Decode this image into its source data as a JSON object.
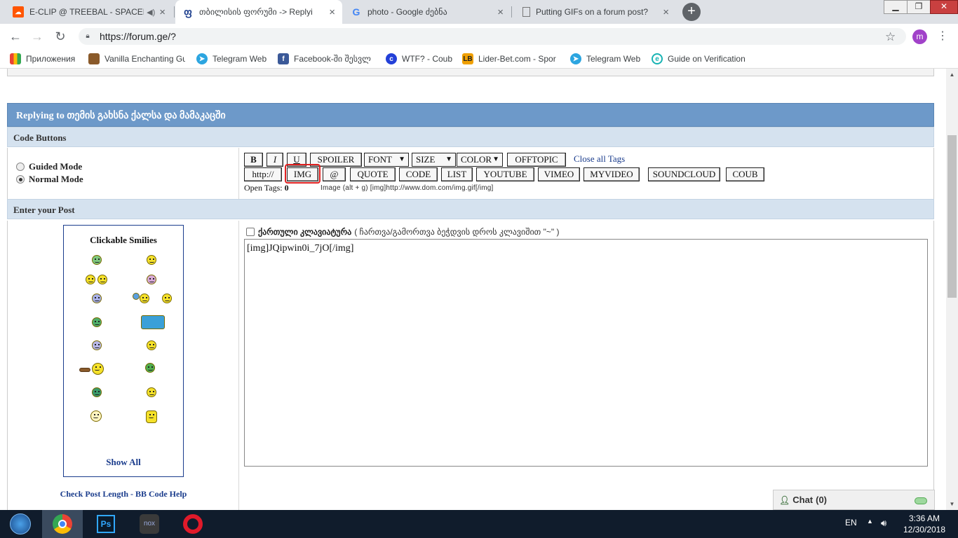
{
  "browser": {
    "tabs": [
      {
        "title": "E-CLIP @ TREEBAL - SPACEH",
        "has_audio": true
      },
      {
        "title": "თბილისის ფორუმი -> Replyi",
        "active": true
      },
      {
        "title": "photo - Google ძებნა"
      },
      {
        "title": "Putting GIFs on a forum post?"
      }
    ],
    "url": "https://forum.ge/?",
    "avatar_letter": "m",
    "bookmarks": [
      {
        "label": "Приложения",
        "icon": "apps-grid-icon"
      },
      {
        "label": "Vanilla Enchanting Gu",
        "icon": "game-icon"
      },
      {
        "label": "Telegram Web",
        "icon": "telegram-icon"
      },
      {
        "label": "Facebook-ში შესვლ",
        "icon": "facebook-icon"
      },
      {
        "label": "WTF? - Coub",
        "icon": "coub-icon"
      },
      {
        "label": "Lider-Bet.com - Spor",
        "icon": "liderbet-icon"
      },
      {
        "label": "Telegram Web",
        "icon": "telegram-icon"
      },
      {
        "label": "Guide on Verification",
        "icon": "guide-icon"
      }
    ]
  },
  "page": {
    "header_title": "Replying to თემის გახსნა ქალსა და მამაკაცში",
    "code_buttons_label": "Code Buttons",
    "modes": {
      "guided": "Guided Mode",
      "normal": "Normal Mode",
      "selected": "normal"
    },
    "row1_buttons": [
      "B",
      "I",
      "U",
      "SPOILER"
    ],
    "selects": {
      "font": "FONT",
      "size": "SIZE",
      "color": "COLOR"
    },
    "offtopic": "OFFTOPIC",
    "close_all": "Close all Tags",
    "row2_buttons": [
      "http://",
      "IMG",
      "@",
      "QUOTE",
      "CODE",
      "LIST",
      "YOUTUBE",
      "VIMEO",
      "MYVIDEO",
      "SOUNDCLOUD",
      "COUB"
    ],
    "open_tags_label": "Open Tags:",
    "open_tags_count": "0",
    "hint": "Image (alt + g) [img]http://www.dom.com/img.gif[/img]",
    "enter_post_label": "Enter your Post",
    "smilies_title": "Clickable Smilies",
    "show_all": "Show All",
    "check_post": "Check Post Length",
    "separator": " - ",
    "bb_help": "BB Code Help",
    "geo_keyboard_bold": "ქართული კლავიატურა",
    "geo_keyboard_note": "( ჩართვა/გამორთვა ბეჭდვის დროს კლავიშით \"~\" )",
    "post_text": "[img]JQipwin0i_7jO[/img]",
    "chat_label": "Chat",
    "chat_count": "(0)"
  },
  "taskbar": {
    "lang": "EN",
    "time": "3:36 AM",
    "date": "12/30/2018",
    "apps": [
      "start-orb-icon",
      "chrome-icon",
      "photoshop-icon",
      "nox-icon",
      "opera-icon"
    ]
  },
  "colors": {
    "header_blue": "#6d99c9",
    "section_bg": "#d5e2ef",
    "link_blue": "#1a3c8c",
    "highlight_red": "#e02020"
  }
}
